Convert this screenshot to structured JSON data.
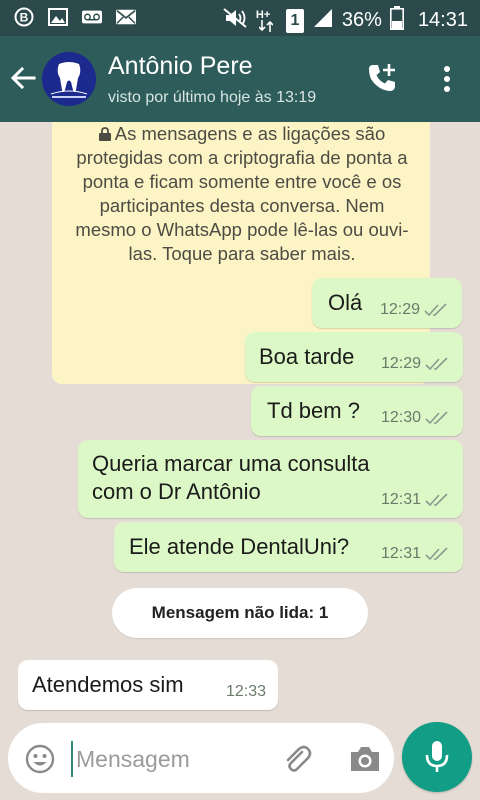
{
  "status_bar": {
    "battery_percent": "36%",
    "time": "14:31",
    "icons_left": [
      "b-badge-icon",
      "image-icon",
      "voicemail-icon",
      "mail-icon"
    ],
    "icons_right": [
      "mute-icon",
      "hplus-icon",
      "sim1-icon",
      "signal-icon",
      "battery-icon"
    ],
    "network_label": "H+",
    "sim_label": "1"
  },
  "header": {
    "contact_name": "Antônio Pere",
    "last_seen": "visto por último hoje às 13:19",
    "icons": [
      "back-arrow-icon",
      "avatar-logo",
      "add-call-icon",
      "more-vertical-icon"
    ]
  },
  "encryption_notice": {
    "text": "As mensagens e as ligações são protegidas com a criptografia de ponta a ponta e ficam somente entre você e os participantes desta conversa. Nem mesmo o WhatsApp pode lê-las ou ouvi-las. Toque para saber mais."
  },
  "messages": [
    {
      "direction": "out",
      "lines": [
        "Olá"
      ],
      "time": "12:29",
      "status": "read"
    },
    {
      "direction": "out",
      "lines": [
        "Boa tarde"
      ],
      "time": "12:29",
      "status": "read"
    },
    {
      "direction": "out",
      "lines": [
        "Td bem ?"
      ],
      "time": "12:30",
      "status": "read"
    },
    {
      "direction": "out",
      "lines": [
        "Queria marcar uma consulta",
        "com o Dr Antônio"
      ],
      "time": "12:31",
      "status": "read"
    },
    {
      "direction": "out",
      "lines": [
        "Ele atende DentalUni?"
      ],
      "time": "12:31",
      "status": "read"
    },
    {
      "direction": "in",
      "lines": [
        "Atendemos sim"
      ],
      "time": "12:33"
    }
  ],
  "unread_divider": {
    "label": "Mensagem não lida: 1"
  },
  "composer": {
    "placeholder": "Mensagem",
    "value": "",
    "icons": [
      "emoji-icon",
      "attach-icon",
      "camera-icon",
      "mic-icon"
    ]
  },
  "colors": {
    "status_bar": "#2c4a4b",
    "app_bar": "#2e5c5a",
    "chat_background": "#e5ddd5",
    "outgoing_bubble": "#dcf8c6",
    "incoming_bubble": "#ffffff",
    "encryption_notice": "#fdf4c5",
    "accent": "#119d86"
  }
}
